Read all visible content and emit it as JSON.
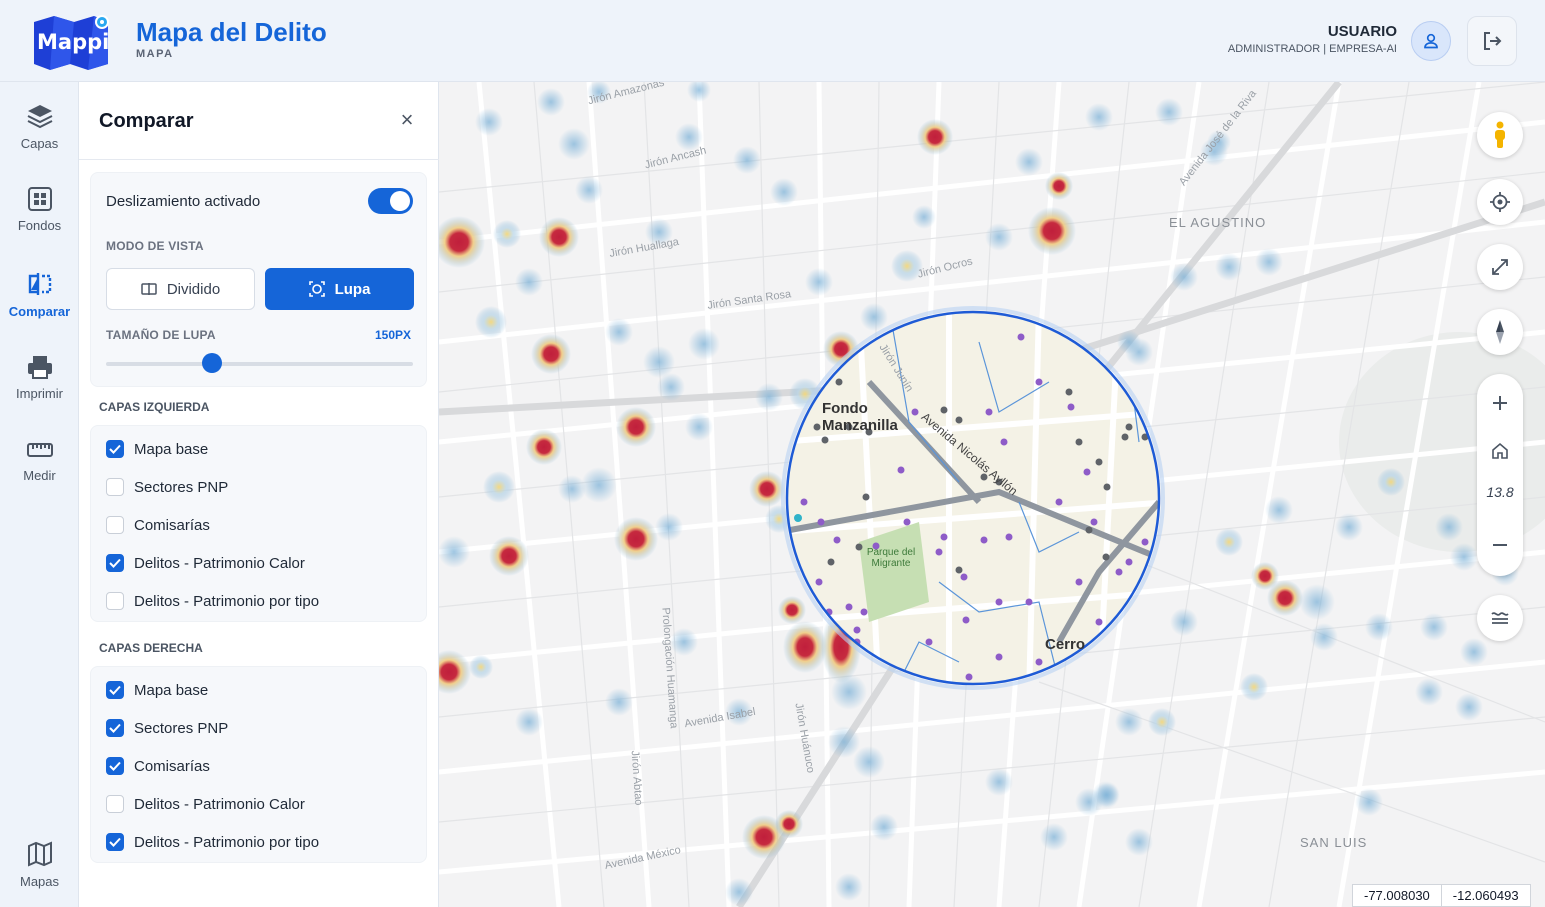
{
  "header": {
    "logo_text": "Mappi",
    "title": "Mapa del Delito",
    "subtitle": "MAPA",
    "user_name": "USUARIO",
    "user_role": "ADMINISTRADOR | EMPRESA-AI"
  },
  "rail": {
    "items": [
      {
        "label": "Capas",
        "icon": "layers-icon"
      },
      {
        "label": "Fondos",
        "icon": "grid-icon"
      },
      {
        "label": "Comparar",
        "icon": "compare-icon"
      },
      {
        "label": "Imprimir",
        "icon": "printer-icon"
      },
      {
        "label": "Medir",
        "icon": "ruler-icon"
      },
      {
        "label": "Mapas",
        "icon": "map-icon"
      }
    ],
    "active": "Comparar"
  },
  "panel": {
    "title": "Comparar",
    "close": "×",
    "swipe_label": "Deslizamiento activado",
    "swipe_enabled": true,
    "view_mode_label": "MODO DE VISTA",
    "mode_split": "Dividido",
    "mode_lens": "Lupa",
    "selected_mode": "Lupa",
    "lens_size_label": "TAMAÑO DE LUPA",
    "lens_size_value": "150PX",
    "left_layers_label": "CAPAS IZQUIERDA",
    "left_layers": [
      {
        "label": "Mapa base",
        "checked": true
      },
      {
        "label": "Sectores PNP",
        "checked": false
      },
      {
        "label": "Comisarías",
        "checked": false
      },
      {
        "label": "Delitos - Patrimonio Calor",
        "checked": true
      },
      {
        "label": "Delitos - Patrimonio por tipo",
        "checked": false
      }
    ],
    "right_layers_label": "CAPAS DERECHA",
    "right_layers": [
      {
        "label": "Mapa base",
        "checked": true
      },
      {
        "label": "Sectores PNP",
        "checked": true
      },
      {
        "label": "Comisarías",
        "checked": true
      },
      {
        "label": "Delitos - Patrimonio Calor",
        "checked": false
      },
      {
        "label": "Delitos - Patrimonio por tipo",
        "checked": true
      }
    ]
  },
  "map": {
    "districts": [
      "EL AGUSTINO",
      "SAN LUIS"
    ],
    "streets": [
      "Jirón Amazonas",
      "Jirón Ancash",
      "Jirón Junín",
      "Jirón Huallaga",
      "Jirón Santa Rosa",
      "Jirón Ocros",
      "Avenida José de la Riva",
      "Jirón Huánuco",
      "Prolongación Huamanga",
      "Avenida Isabel",
      "Avenida México",
      "Jirón Abtao",
      "Avenida Nicolás Ayllón",
      "Parque del Migrante",
      "Fondo Manzanilla",
      "Cerro"
    ],
    "zoom": "13.8",
    "lon": "-77.008030",
    "lat": "-12.060493",
    "accent": "#1565d8"
  }
}
